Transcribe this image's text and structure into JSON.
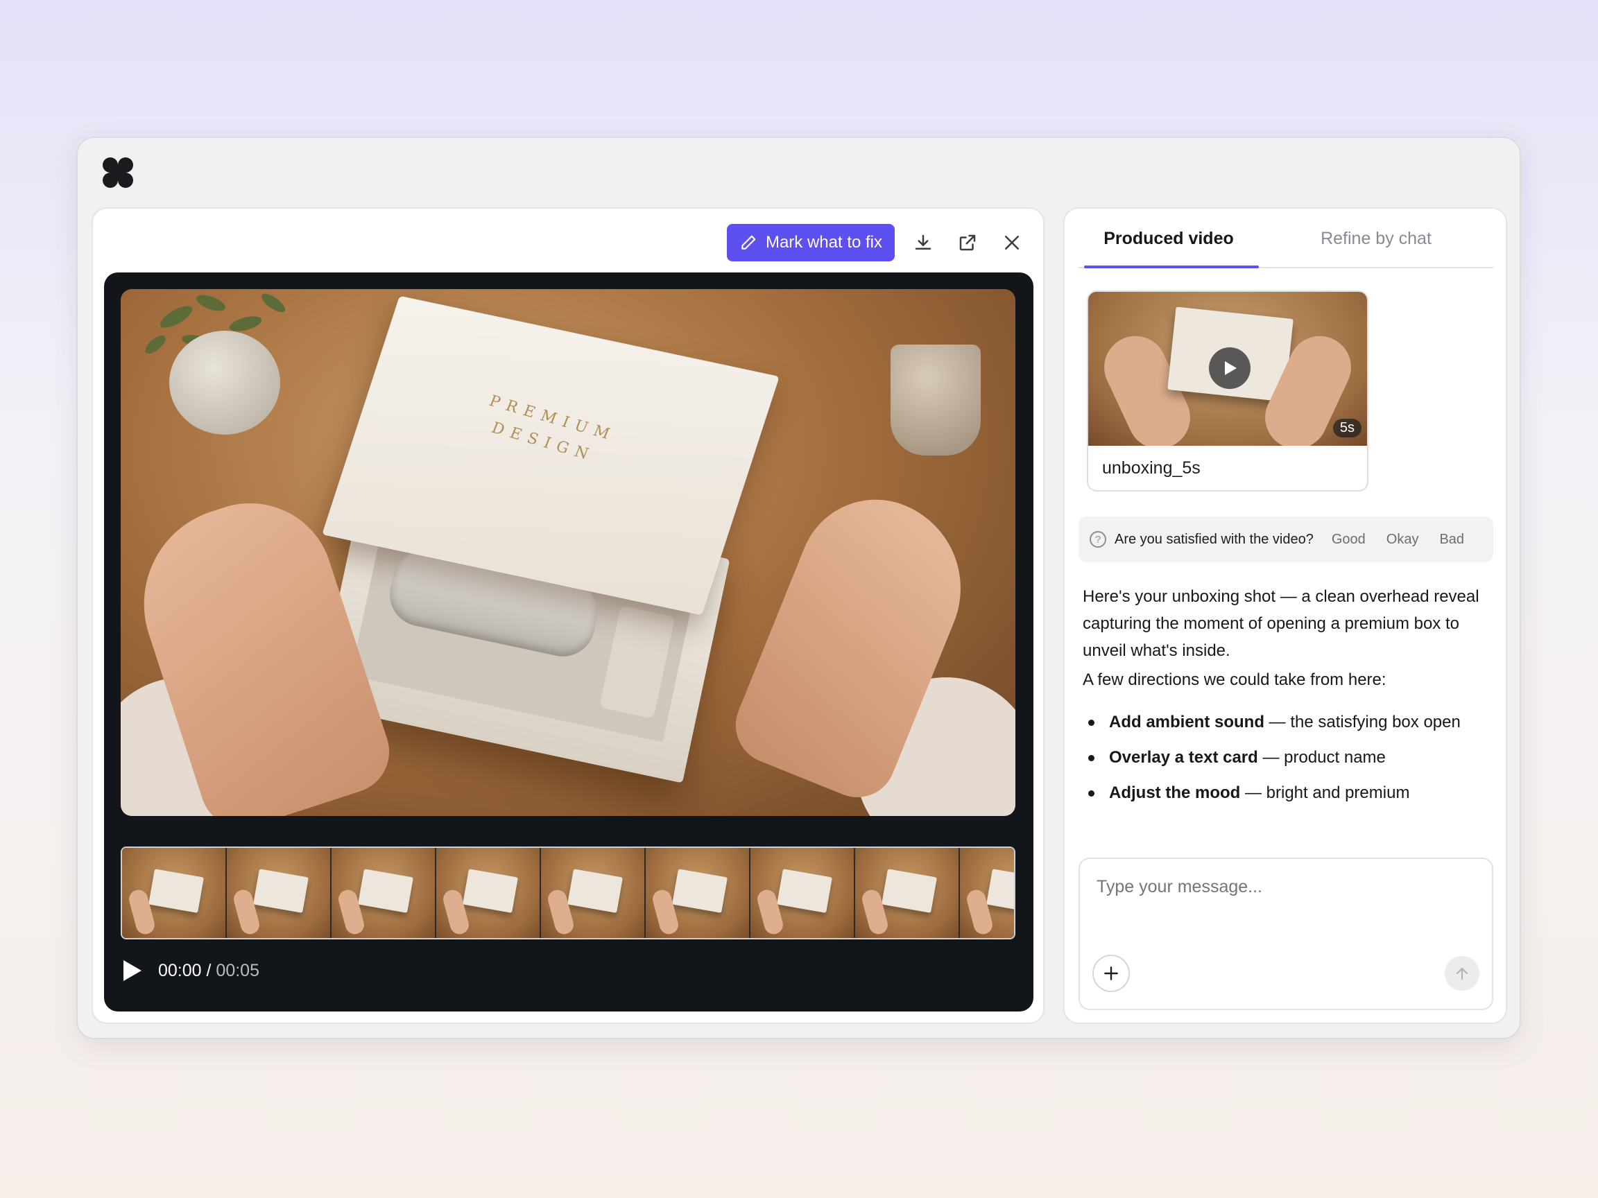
{
  "toolbar": {
    "mark_label": "Mark what to fix",
    "download_icon": "download-icon",
    "open_external_icon": "external-link-icon",
    "close_icon": "close-icon"
  },
  "player": {
    "current_time": "00:00",
    "separator": "/",
    "duration": "00:05",
    "frame_count": 9
  },
  "tabs": [
    {
      "label": "Produced video",
      "active": true
    },
    {
      "label": "Refine by chat",
      "active": false
    }
  ],
  "video_card": {
    "name": "unboxing_5s",
    "duration_badge": "5s"
  },
  "feedback": {
    "question": "Are you satisfied with the video?",
    "options": [
      "Good",
      "Okay",
      "Bad"
    ]
  },
  "message": {
    "intro": "Here's your unboxing shot — a clean overhead reveal capturing the moment of opening a premium box to unveil what's inside.",
    "lead": "A few directions we could take from here:",
    "suggestions": [
      {
        "title": "Add ambient sound",
        "detail": " — the satisfying box open"
      },
      {
        "title": "Overlay a text card",
        "detail": " — product name"
      },
      {
        "title": "Adjust the mood",
        "detail": " — bright and premium"
      }
    ]
  },
  "composer": {
    "placeholder": "Type your message..."
  },
  "lid_text": {
    "line1": "PREMIUM",
    "line2": "DESIGN"
  },
  "colors": {
    "accent": "#5d4ff0",
    "player_bg": "#12161b"
  }
}
